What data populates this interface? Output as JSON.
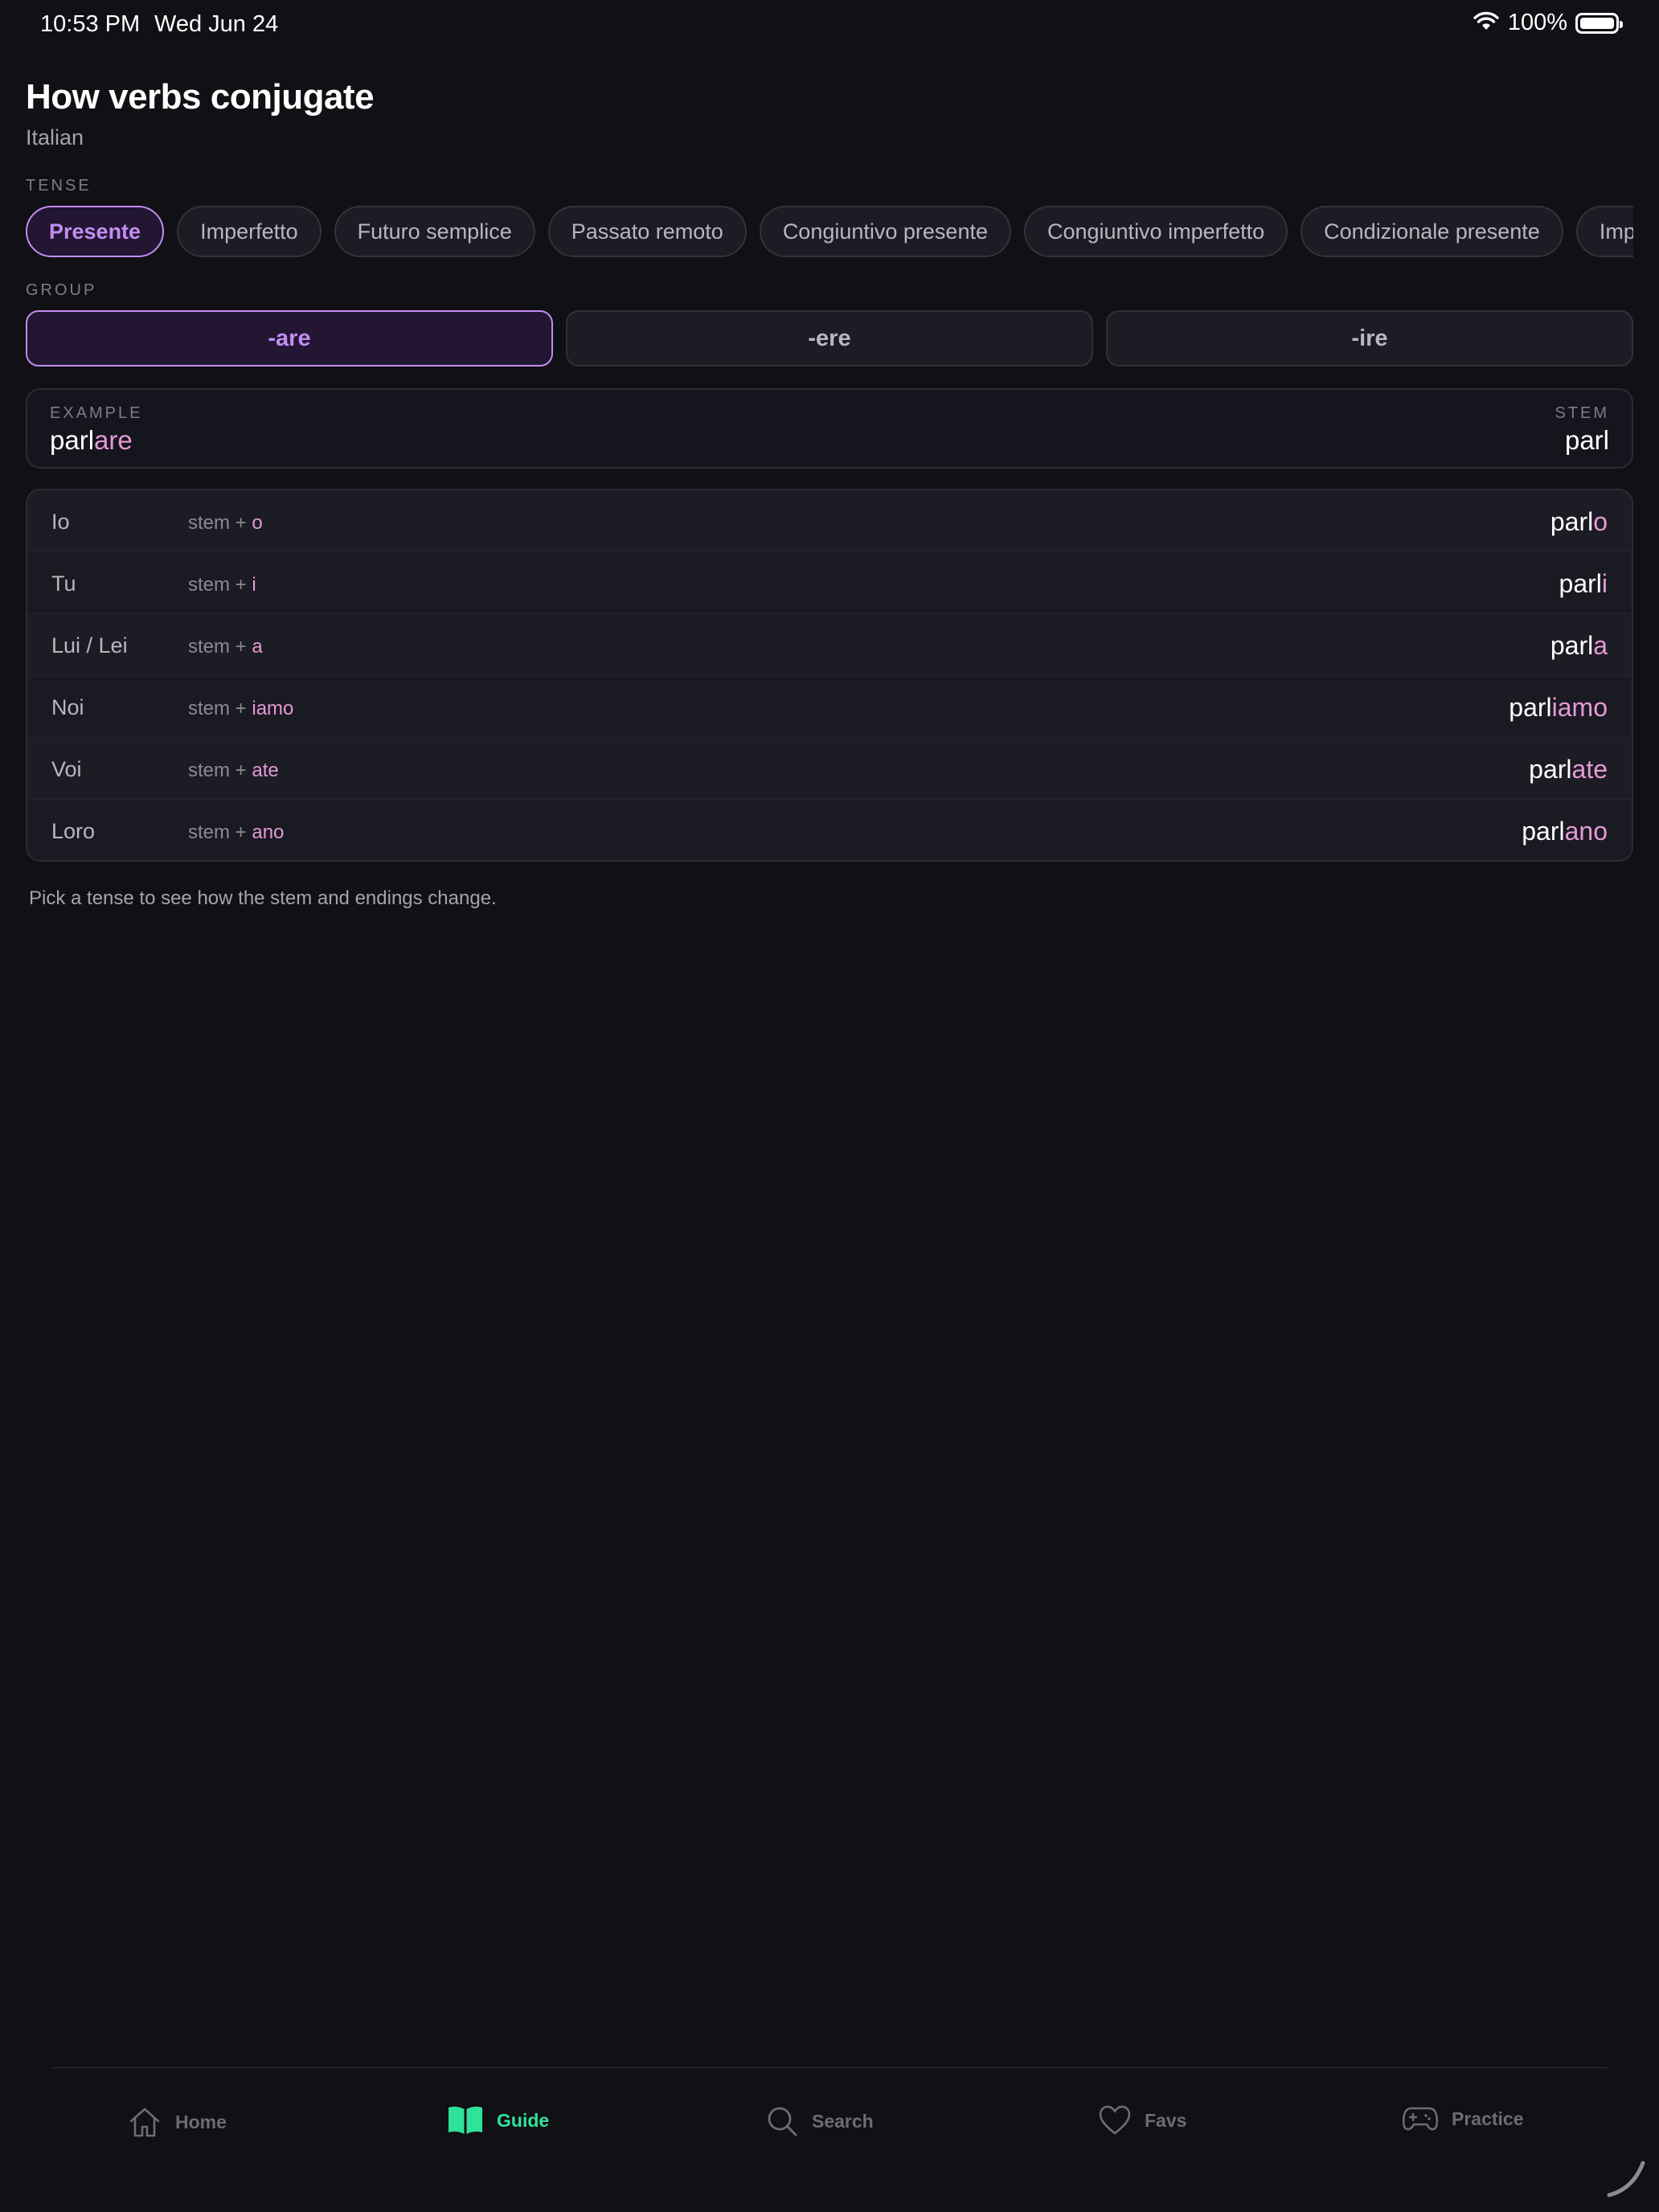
{
  "status_bar": {
    "time": "10:53 PM",
    "date": "Wed Jun 24",
    "battery": "100%"
  },
  "header": {
    "title": "How verbs conjugate",
    "subtitle": "Italian"
  },
  "tense": {
    "label": "TENSE",
    "selected": "Presente",
    "options": [
      "Presente",
      "Imperfetto",
      "Futuro semplice",
      "Passato remoto",
      "Congiuntivo presente",
      "Congiuntivo imperfetto",
      "Condizionale presente",
      "Imperativo"
    ]
  },
  "group": {
    "label": "GROUP",
    "selected": "-are",
    "options": [
      "-are",
      "-ere",
      "-ire"
    ]
  },
  "example": {
    "label": "EXAMPLE",
    "stem": "parl",
    "ending": "are",
    "stem_label": "STEM",
    "stem_value": "parl"
  },
  "conjugations": [
    {
      "pronoun": "Io",
      "rule_prefix": "stem + ",
      "ending": "o",
      "stem": "parl"
    },
    {
      "pronoun": "Tu",
      "rule_prefix": "stem + ",
      "ending": "i",
      "stem": "parl"
    },
    {
      "pronoun": "Lui / Lei",
      "rule_prefix": "stem + ",
      "ending": "a",
      "stem": "parl"
    },
    {
      "pronoun": "Noi",
      "rule_prefix": "stem + ",
      "ending": "iamo",
      "stem": "parl"
    },
    {
      "pronoun": "Voi",
      "rule_prefix": "stem + ",
      "ending": "ate",
      "stem": "parl"
    },
    {
      "pronoun": "Loro",
      "rule_prefix": "stem + ",
      "ending": "ano",
      "stem": "parl"
    }
  ],
  "hint": "Pick a tense to see how the stem and endings change.",
  "tabs": [
    {
      "label": "Home",
      "icon": "home-icon"
    },
    {
      "label": "Guide",
      "icon": "book-icon",
      "active": true
    },
    {
      "label": "Search",
      "icon": "search-icon"
    },
    {
      "label": "Favs",
      "icon": "heart-icon"
    },
    {
      "label": "Practice",
      "icon": "gamepad-icon"
    }
  ],
  "colors": {
    "accent_purple": "#c38df0",
    "ending_pink": "#e59ad6",
    "active_tab_green": "#2fe39a",
    "background": "#101015"
  }
}
